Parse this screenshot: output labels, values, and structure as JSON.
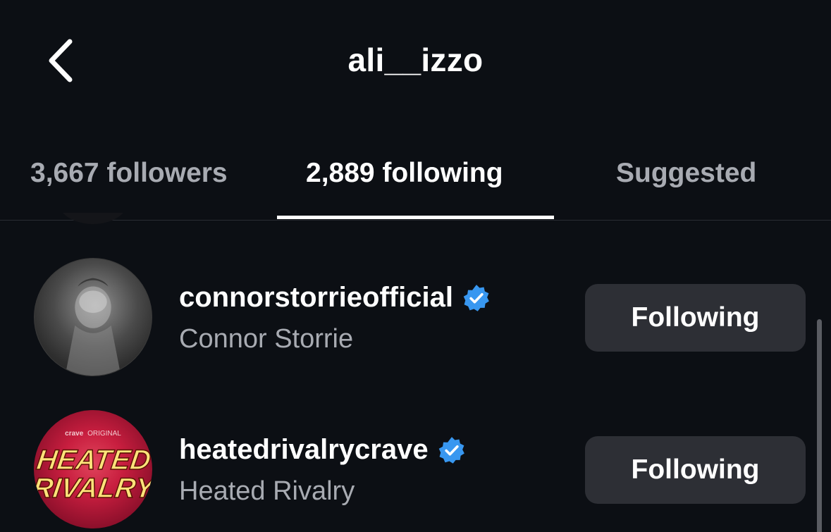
{
  "header": {
    "title": "ali__izzo",
    "back_icon": "chevron-left-icon"
  },
  "tabs": [
    {
      "label": "3,667 followers",
      "active": false
    },
    {
      "label": "2,889 following",
      "active": true
    },
    {
      "label": "Suggested",
      "active": false
    }
  ],
  "list": {
    "items": [
      {
        "username": "connorstorrieofficial",
        "full_name": "Connor Storrie",
        "verified": true,
        "button_label": "Following"
      },
      {
        "username": "heatedrivalrycrave",
        "full_name": "Heated Rivalry",
        "verified": true,
        "button_label": "Following",
        "avatar_text": {
          "brand": "crave",
          "tag": "ORIGINAL",
          "line1": "HEATED",
          "line2": "RIVALRY"
        }
      }
    ]
  },
  "colors": {
    "background": "#0c0f14",
    "verified_blue": "#3897f0",
    "button_bg": "#2d2f35",
    "secondary_text": "#a8abb2"
  }
}
